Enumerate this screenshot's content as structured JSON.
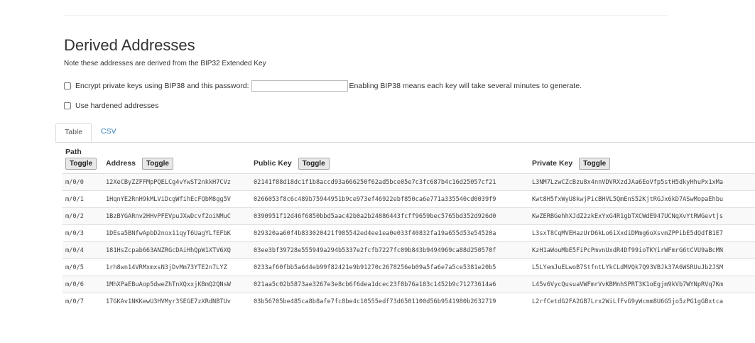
{
  "section": {
    "title": "Derived Addresses",
    "note": "Note these addresses are derived from the BIP32 Extended Key"
  },
  "bip38": {
    "label": "Encrypt private keys using BIP38 and this password:",
    "password_value": "",
    "hint": "Enabling BIP38 means each key will take several minutes to generate."
  },
  "hardened": {
    "label": "Use hardened addresses"
  },
  "tabs": [
    {
      "label": "Table"
    },
    {
      "label": "CSV"
    }
  ],
  "table": {
    "headers": {
      "path": "Path",
      "address": "Address",
      "public_key": "Public Key",
      "private_key": "Private Key",
      "toggle": "Toggle"
    },
    "rows": [
      {
        "path": "m/0/0",
        "address": "12XeCByZZFFMpPQELCg4vYwST2nkkH7CVz",
        "pubkey": "02141f88d18dc1f1b8accd93a666250f62ad5bce05e7c3fc687b4c16d25057cf21",
        "privkey": "L3NM7LzwCZcBzu8x4nnVDVRXzdJAa6EoVfp5stH5dkyHhuPx1xMa"
      },
      {
        "path": "m/0/1",
        "address": "1HqnYE2RnH9kMLViDcgWfihEcFQbM8gg5V",
        "pubkey": "0266053f8c6c489b75944951b9ce973ef46922ebf850ca6e771a335540cd0039f9",
        "privkey": "Kwt8H5fxWyU8kwjPicBHVL5QmEnS52KjtRGJx6kD7ASwMopaEhbu"
      },
      {
        "path": "m/0/2",
        "address": "1BzBYGARnv2HHvPFEVpuJXwDcvf2oiNMuC",
        "pubkey": "0390951f12d46f6850bbd5aac42b0a2b24886443fcff9659bec5765bd352d926d0",
        "privkey": "KwZERBGehhXJdZ2zkExYxG4R1gbTXCWdE947UCNqXvYtRWGevtjs"
      },
      {
        "path": "m/0/3",
        "address": "1DEsa5BNfwApbD2nox11qyT6UagYLfEFbK",
        "pubkey": "029320aa60f4b833020421f985542ed4ee1ea0e033f40832fa19a655d53e54520a",
        "privkey": "L3sxT8CqMVEHazUrD6kLo6iXxdiDMmg6oXsvmZPPibE5dQdfB1E7"
      },
      {
        "path": "m/0/4",
        "address": "181HsZcpab663ANZRGcDAiHhQpW1XTV6XQ",
        "pubkey": "03ee3bf39728e555949a294b5337e2fcfb7227fc09b843b9494969ca88d250570f",
        "privkey": "KzH1aWouMbE5FiPcPmvnUxdR4Df99ioTKYirWFmrG6tCVU9aBcMN"
      },
      {
        "path": "m/0/5",
        "address": "1rh8wn14VRMxmxsN3jDvMm73YTE2n7LYZ",
        "pubkey": "0233af60fbb5a644eb99f82421e9b91270c2678256eb09a5fa6e7a5ce5381e20b5",
        "privkey": "L5LYemJuELwoB7StfntLYkCLdMVQk7Q93VBJk37A6WSRUuJb2JSM"
      },
      {
        "path": "m/0/6",
        "address": "1MhXPaEBuAop5dweZhTnXQxxjKBmQ2QNsW",
        "pubkey": "021aa5c02b5873ae3267e3e8cb6f6dea1dcec23f8b76a183c1452b9c71273614a6",
        "privkey": "L45v6VycQusuaVWFmrVvKBMnhSPRT3K1oEgjm9kVb7WYNpRVq7Km"
      },
      {
        "path": "m/0/7",
        "address": "17GKAv1NKKewU3HVMyr3SEGE7zXRdNBTUv",
        "pubkey": "03b56705be485ca8b8afe7fc8be4c10555edf73d6501100d56b9541980b2632719",
        "privkey": "L2rfCetdG2FA2GB7Lrx2WiLfFvG9yWcmm8U6G5jo5zPG1gGBxtca"
      }
    ]
  }
}
